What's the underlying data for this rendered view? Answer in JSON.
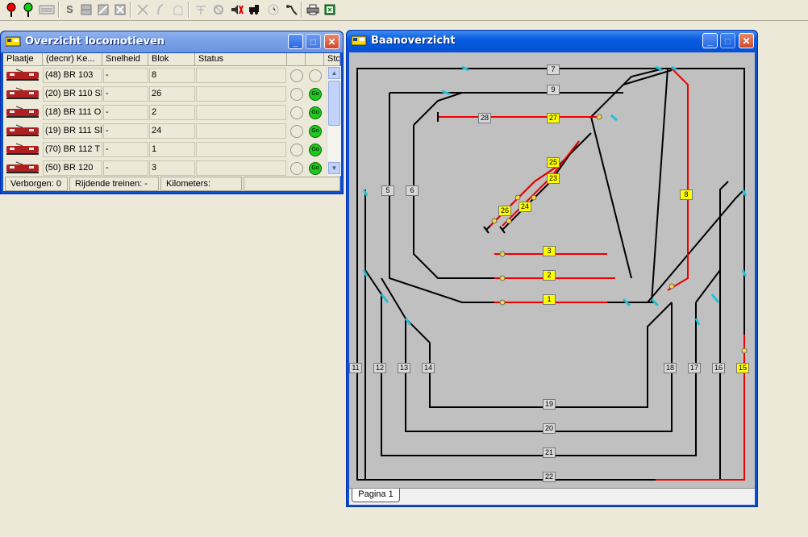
{
  "toolbar": {
    "buttons": [
      "signal-red-icon",
      "signal-green-icon",
      "keyboard-icon",
      "s-icon",
      "panel-icon",
      "turnout-icon",
      "cross-icon",
      "no-switch-icon",
      "no-signal-icon",
      "ghost-icon",
      "route-icon",
      "gear-off-icon",
      "sound-icon",
      "train-icon",
      "clock-icon",
      "magic-icon",
      "print-icon",
      "export-icon"
    ],
    "s_label": "S"
  },
  "loco_window": {
    "title": "Overzicht locomotieven",
    "columns": [
      "Plaatje",
      "(decnr) Ke...",
      "Snelheid",
      "Blok",
      "Status",
      "",
      "",
      "Sto"
    ],
    "rows": [
      {
        "name": "(48) BR 103",
        "speed": "-",
        "block": "8",
        "status": "",
        "go": false
      },
      {
        "name": "(20) BR 110 Sl",
        "speed": "-",
        "block": "26",
        "status": "",
        "go": true
      },
      {
        "name": "(18) BR 111 O",
        "speed": "-",
        "block": "2",
        "status": "",
        "go": true
      },
      {
        "name": "(19) BR 111 Sl",
        "speed": "-",
        "block": "24",
        "status": "",
        "go": true
      },
      {
        "name": "(70) BR 112 T",
        "speed": "-",
        "block": "1",
        "status": "",
        "go": true
      },
      {
        "name": "(50) BR 120",
        "speed": "-",
        "block": "3",
        "status": "",
        "go": true
      }
    ],
    "go_label": "Go",
    "statusbar": {
      "hidden": "Verborgen: 0",
      "driving": "Rijdende treinen: -",
      "km": "Kilometers:"
    }
  },
  "track_window": {
    "title": "Baanoverzicht",
    "tab": "Pagina 1",
    "blocks": {
      "b7": "7",
      "b9": "9",
      "b28": "28",
      "b27": "27",
      "b25": "25",
      "b23": "23",
      "b24": "24",
      "b26": "26",
      "b5": "5",
      "b6": "6",
      "b8": "8",
      "b3": "3",
      "b2": "2",
      "b1": "1",
      "b11": "11",
      "b12": "12",
      "b13": "13",
      "b14": "14",
      "b18": "18",
      "b17": "17",
      "b16": "16",
      "b15": "15",
      "b19": "19",
      "b20": "20",
      "b21": "21",
      "b22": "22"
    }
  }
}
